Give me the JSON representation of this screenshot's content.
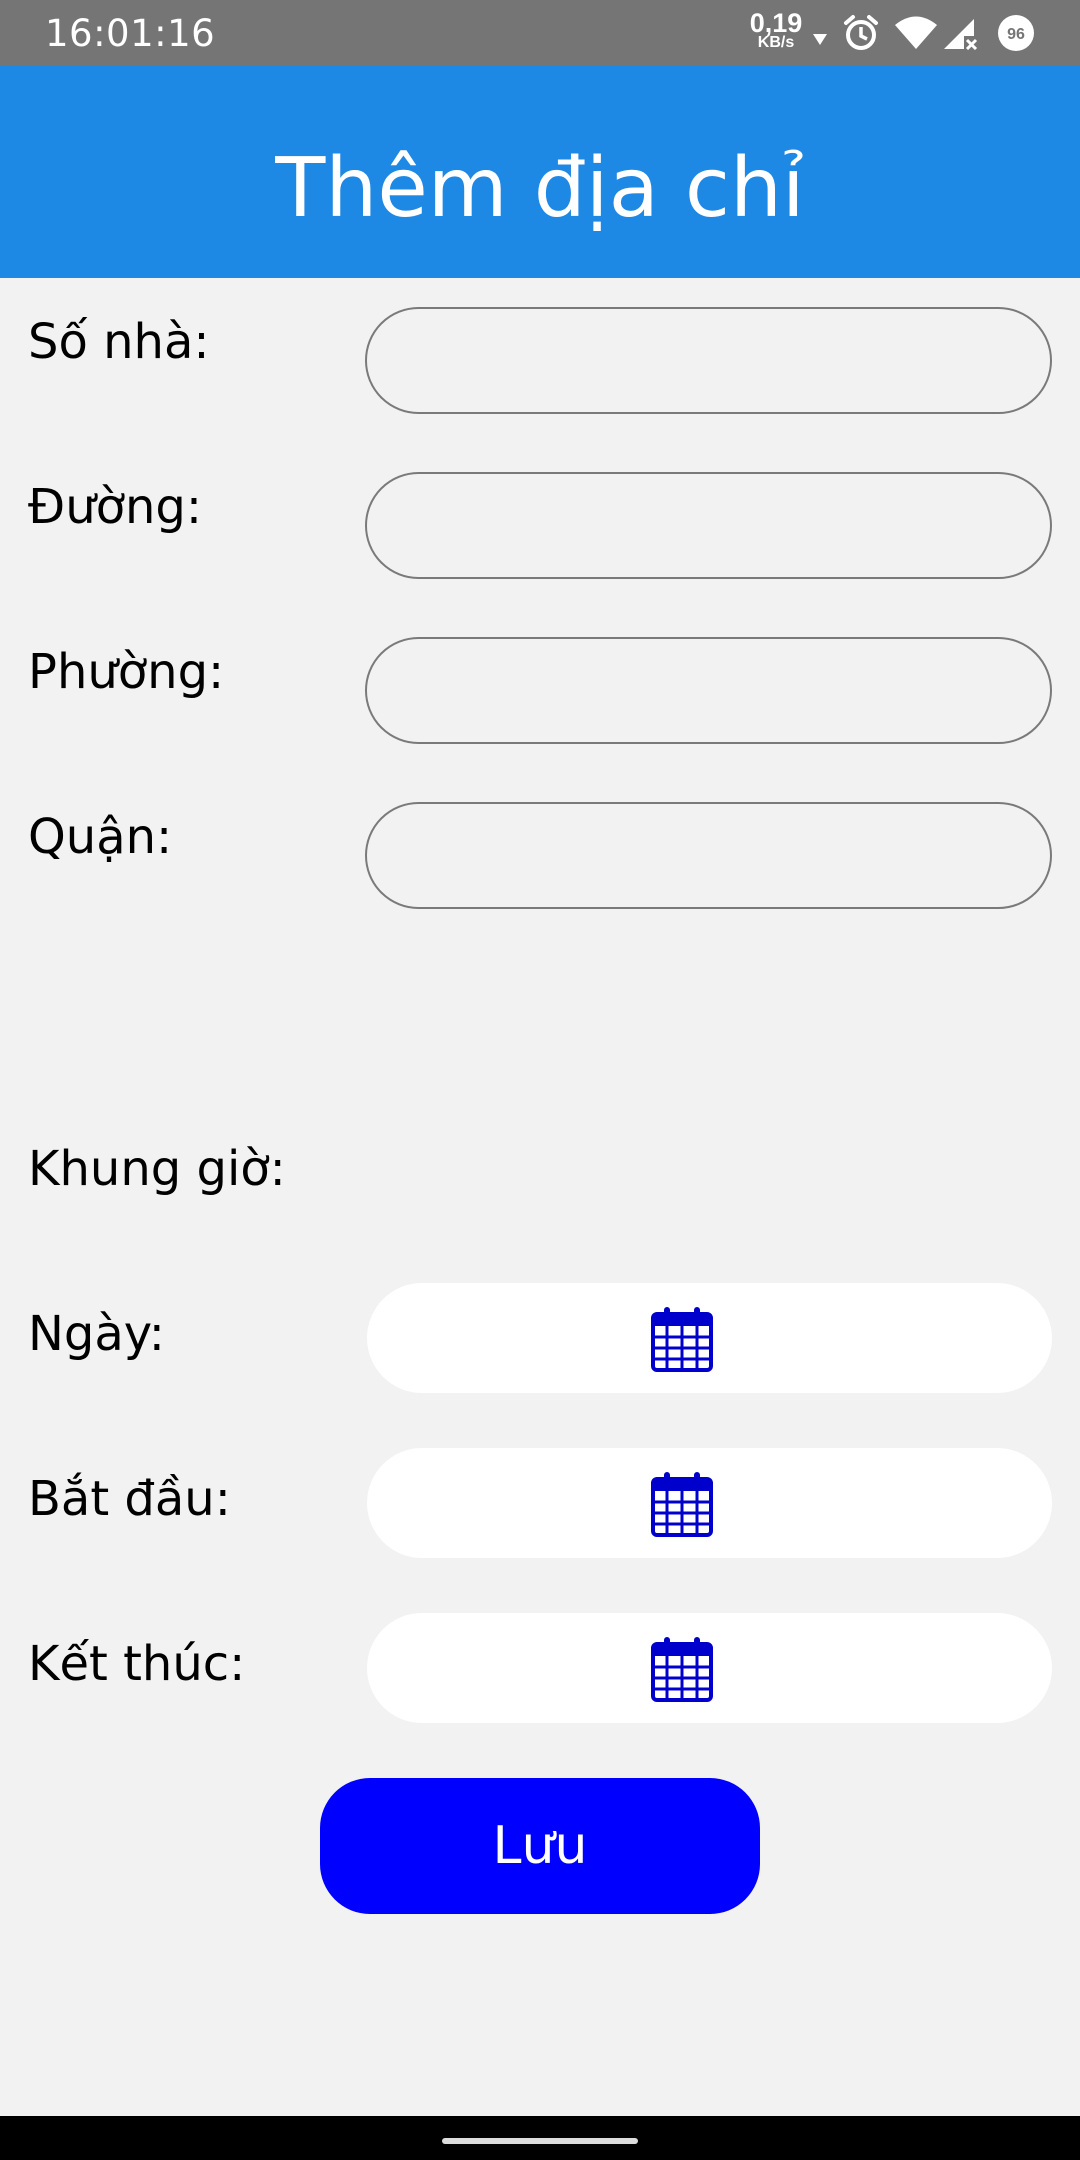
{
  "status_bar": {
    "time": "16:01:16",
    "net_speed_value": "0,19",
    "net_speed_unit": "KB/s",
    "battery_level": "96",
    "icons": [
      "download-arrow-icon",
      "alarm-icon",
      "wifi-icon",
      "cell-signal-icon",
      "battery-icon"
    ]
  },
  "app_bar": {
    "title": "Thêm địa chỉ",
    "color": "#1e88e5"
  },
  "address_form": {
    "house_number": {
      "label": "Số nhà:",
      "value": ""
    },
    "street": {
      "label": "Đường:",
      "value": ""
    },
    "ward": {
      "label": "Phường:",
      "value": ""
    },
    "district": {
      "label": "Quận:",
      "value": ""
    }
  },
  "time_slot": {
    "heading": "Khung giờ:",
    "date": {
      "label": "Ngày:",
      "icon": "calendar-icon"
    },
    "start": {
      "label": "Bắt đầu:",
      "icon": "calendar-icon"
    },
    "end": {
      "label": "Kết thúc:",
      "icon": "calendar-icon"
    }
  },
  "save_button": {
    "label": "Lưu",
    "color": "#0000ff"
  }
}
